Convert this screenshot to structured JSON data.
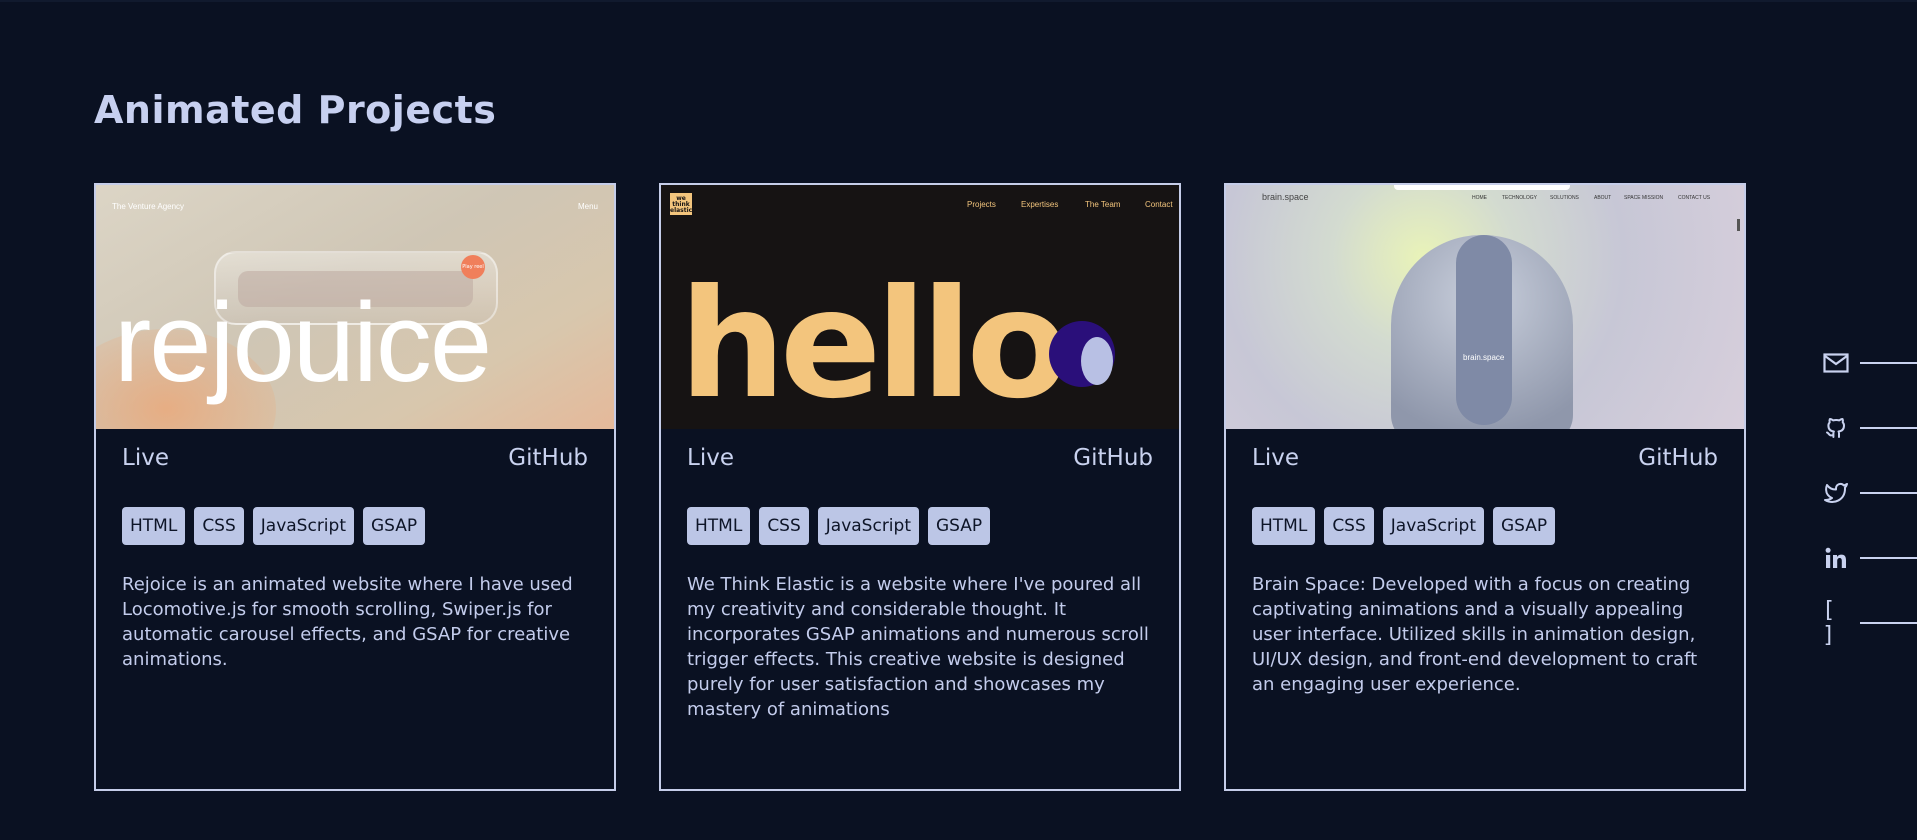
{
  "section": {
    "title": "Animated Projects"
  },
  "projects": [
    {
      "thumb": {
        "word": "rejouice",
        "nav_left": "The Venture Agency",
        "nav_right": "Menu",
        "badge": "Play reel"
      },
      "live_label": "Live",
      "github_label": "GitHub",
      "tags": [
        "HTML",
        "CSS",
        "JavaScript",
        "GSAP"
      ],
      "description": "Rejoice is an animated website where I have used Locomotive.js for smooth scrolling, Swiper.js for automatic carousel effects, and GSAP for creative animations."
    },
    {
      "thumb": {
        "word": "hello",
        "logo": "we think elastic",
        "nav": [
          "Projects",
          "Expertises",
          "The Team",
          "Contact"
        ]
      },
      "live_label": "Live",
      "github_label": "GitHub",
      "tags": [
        "HTML",
        "CSS",
        "JavaScript",
        "GSAP"
      ],
      "description": "We Think Elastic is a website where I've poured all my creativity and considerable thought. It incorporates GSAP animations and numerous scroll trigger effects. This creative website is designed purely for user satisfaction and showcases my mastery of animations"
    },
    {
      "thumb": {
        "brand": "brain.space",
        "helmet_label": "brain.space",
        "nav": [
          "HOME",
          "TECHNOLOGY",
          "SOLUTIONS",
          "ABOUT",
          "SPACE MISSION",
          "CONTACT US"
        ]
      },
      "live_label": "Live",
      "github_label": "GitHub",
      "tags": [
        "HTML",
        "CSS",
        "JavaScript",
        "GSAP"
      ],
      "description": "Brain Space: Developed with a focus on creating captivating animations and a visually appealing user interface. Utilized skills in animation design, UI/UX design, and front-end development to craft an engaging user experience."
    }
  ],
  "social": {
    "icons": [
      "mail-icon",
      "github-icon",
      "twitter-icon",
      "linkedin-icon",
      "resume-icon"
    ],
    "resume_glyph": "[ ]"
  },
  "colors": {
    "background": "#0a1122",
    "accent": "#c5cde9",
    "tag_bg": "#bcc6e6",
    "hello_yellow": "#f3c57d"
  }
}
